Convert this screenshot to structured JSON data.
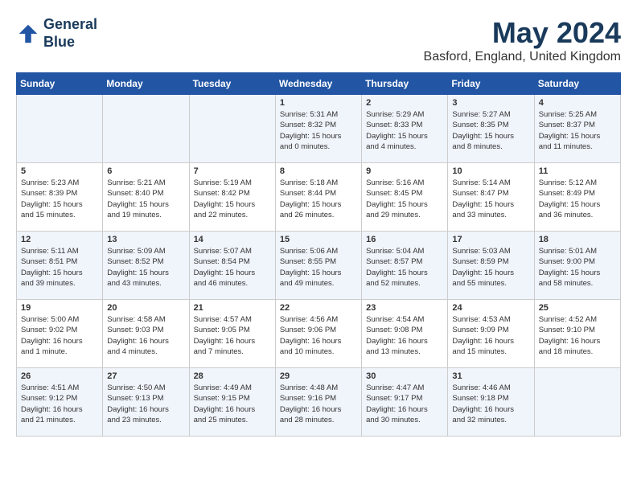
{
  "header": {
    "logo_line1": "General",
    "logo_line2": "Blue",
    "month_title": "May 2024",
    "location": "Basford, England, United Kingdom"
  },
  "days_of_week": [
    "Sunday",
    "Monday",
    "Tuesday",
    "Wednesday",
    "Thursday",
    "Friday",
    "Saturday"
  ],
  "weeks": [
    [
      {
        "day": "",
        "info": ""
      },
      {
        "day": "",
        "info": ""
      },
      {
        "day": "",
        "info": ""
      },
      {
        "day": "1",
        "info": "Sunrise: 5:31 AM\nSunset: 8:32 PM\nDaylight: 15 hours\nand 0 minutes."
      },
      {
        "day": "2",
        "info": "Sunrise: 5:29 AM\nSunset: 8:33 PM\nDaylight: 15 hours\nand 4 minutes."
      },
      {
        "day": "3",
        "info": "Sunrise: 5:27 AM\nSunset: 8:35 PM\nDaylight: 15 hours\nand 8 minutes."
      },
      {
        "day": "4",
        "info": "Sunrise: 5:25 AM\nSunset: 8:37 PM\nDaylight: 15 hours\nand 11 minutes."
      }
    ],
    [
      {
        "day": "5",
        "info": "Sunrise: 5:23 AM\nSunset: 8:39 PM\nDaylight: 15 hours\nand 15 minutes."
      },
      {
        "day": "6",
        "info": "Sunrise: 5:21 AM\nSunset: 8:40 PM\nDaylight: 15 hours\nand 19 minutes."
      },
      {
        "day": "7",
        "info": "Sunrise: 5:19 AM\nSunset: 8:42 PM\nDaylight: 15 hours\nand 22 minutes."
      },
      {
        "day": "8",
        "info": "Sunrise: 5:18 AM\nSunset: 8:44 PM\nDaylight: 15 hours\nand 26 minutes."
      },
      {
        "day": "9",
        "info": "Sunrise: 5:16 AM\nSunset: 8:45 PM\nDaylight: 15 hours\nand 29 minutes."
      },
      {
        "day": "10",
        "info": "Sunrise: 5:14 AM\nSunset: 8:47 PM\nDaylight: 15 hours\nand 33 minutes."
      },
      {
        "day": "11",
        "info": "Sunrise: 5:12 AM\nSunset: 8:49 PM\nDaylight: 15 hours\nand 36 minutes."
      }
    ],
    [
      {
        "day": "12",
        "info": "Sunrise: 5:11 AM\nSunset: 8:51 PM\nDaylight: 15 hours\nand 39 minutes."
      },
      {
        "day": "13",
        "info": "Sunrise: 5:09 AM\nSunset: 8:52 PM\nDaylight: 15 hours\nand 43 minutes."
      },
      {
        "day": "14",
        "info": "Sunrise: 5:07 AM\nSunset: 8:54 PM\nDaylight: 15 hours\nand 46 minutes."
      },
      {
        "day": "15",
        "info": "Sunrise: 5:06 AM\nSunset: 8:55 PM\nDaylight: 15 hours\nand 49 minutes."
      },
      {
        "day": "16",
        "info": "Sunrise: 5:04 AM\nSunset: 8:57 PM\nDaylight: 15 hours\nand 52 minutes."
      },
      {
        "day": "17",
        "info": "Sunrise: 5:03 AM\nSunset: 8:59 PM\nDaylight: 15 hours\nand 55 minutes."
      },
      {
        "day": "18",
        "info": "Sunrise: 5:01 AM\nSunset: 9:00 PM\nDaylight: 15 hours\nand 58 minutes."
      }
    ],
    [
      {
        "day": "19",
        "info": "Sunrise: 5:00 AM\nSunset: 9:02 PM\nDaylight: 16 hours\nand 1 minute."
      },
      {
        "day": "20",
        "info": "Sunrise: 4:58 AM\nSunset: 9:03 PM\nDaylight: 16 hours\nand 4 minutes."
      },
      {
        "day": "21",
        "info": "Sunrise: 4:57 AM\nSunset: 9:05 PM\nDaylight: 16 hours\nand 7 minutes."
      },
      {
        "day": "22",
        "info": "Sunrise: 4:56 AM\nSunset: 9:06 PM\nDaylight: 16 hours\nand 10 minutes."
      },
      {
        "day": "23",
        "info": "Sunrise: 4:54 AM\nSunset: 9:08 PM\nDaylight: 16 hours\nand 13 minutes."
      },
      {
        "day": "24",
        "info": "Sunrise: 4:53 AM\nSunset: 9:09 PM\nDaylight: 16 hours\nand 15 minutes."
      },
      {
        "day": "25",
        "info": "Sunrise: 4:52 AM\nSunset: 9:10 PM\nDaylight: 16 hours\nand 18 minutes."
      }
    ],
    [
      {
        "day": "26",
        "info": "Sunrise: 4:51 AM\nSunset: 9:12 PM\nDaylight: 16 hours\nand 21 minutes."
      },
      {
        "day": "27",
        "info": "Sunrise: 4:50 AM\nSunset: 9:13 PM\nDaylight: 16 hours\nand 23 minutes."
      },
      {
        "day": "28",
        "info": "Sunrise: 4:49 AM\nSunset: 9:15 PM\nDaylight: 16 hours\nand 25 minutes."
      },
      {
        "day": "29",
        "info": "Sunrise: 4:48 AM\nSunset: 9:16 PM\nDaylight: 16 hours\nand 28 minutes."
      },
      {
        "day": "30",
        "info": "Sunrise: 4:47 AM\nSunset: 9:17 PM\nDaylight: 16 hours\nand 30 minutes."
      },
      {
        "day": "31",
        "info": "Sunrise: 4:46 AM\nSunset: 9:18 PM\nDaylight: 16 hours\nand 32 minutes."
      },
      {
        "day": "",
        "info": ""
      }
    ]
  ]
}
